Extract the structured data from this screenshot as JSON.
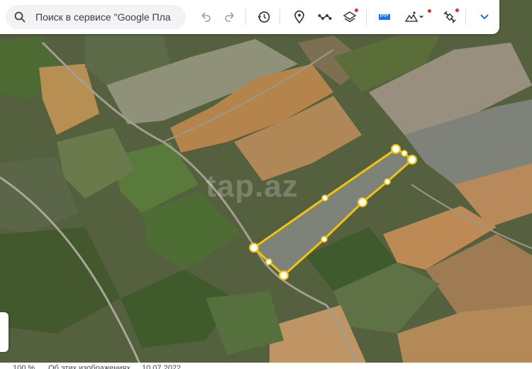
{
  "search": {
    "placeholder": "Поиск в сервисе \"Google Пла"
  },
  "toolbar": {
    "buttons": [
      "undo-icon",
      "redo-icon",
      "history-icon",
      "placemark-icon",
      "path-icon",
      "layers-icon",
      "ruler-icon",
      "terrain-icon",
      "satellite-icon",
      "chevron-down-icon"
    ],
    "accent": "#1a73e8",
    "notify_color": "#d93025"
  },
  "map": {
    "watermark": "tap.az",
    "polygon_color": "#f4c20d"
  },
  "status_bar": {
    "zoom": "100 %",
    "caption": "Об этих изображениях",
    "date": "10.07.2022"
  }
}
